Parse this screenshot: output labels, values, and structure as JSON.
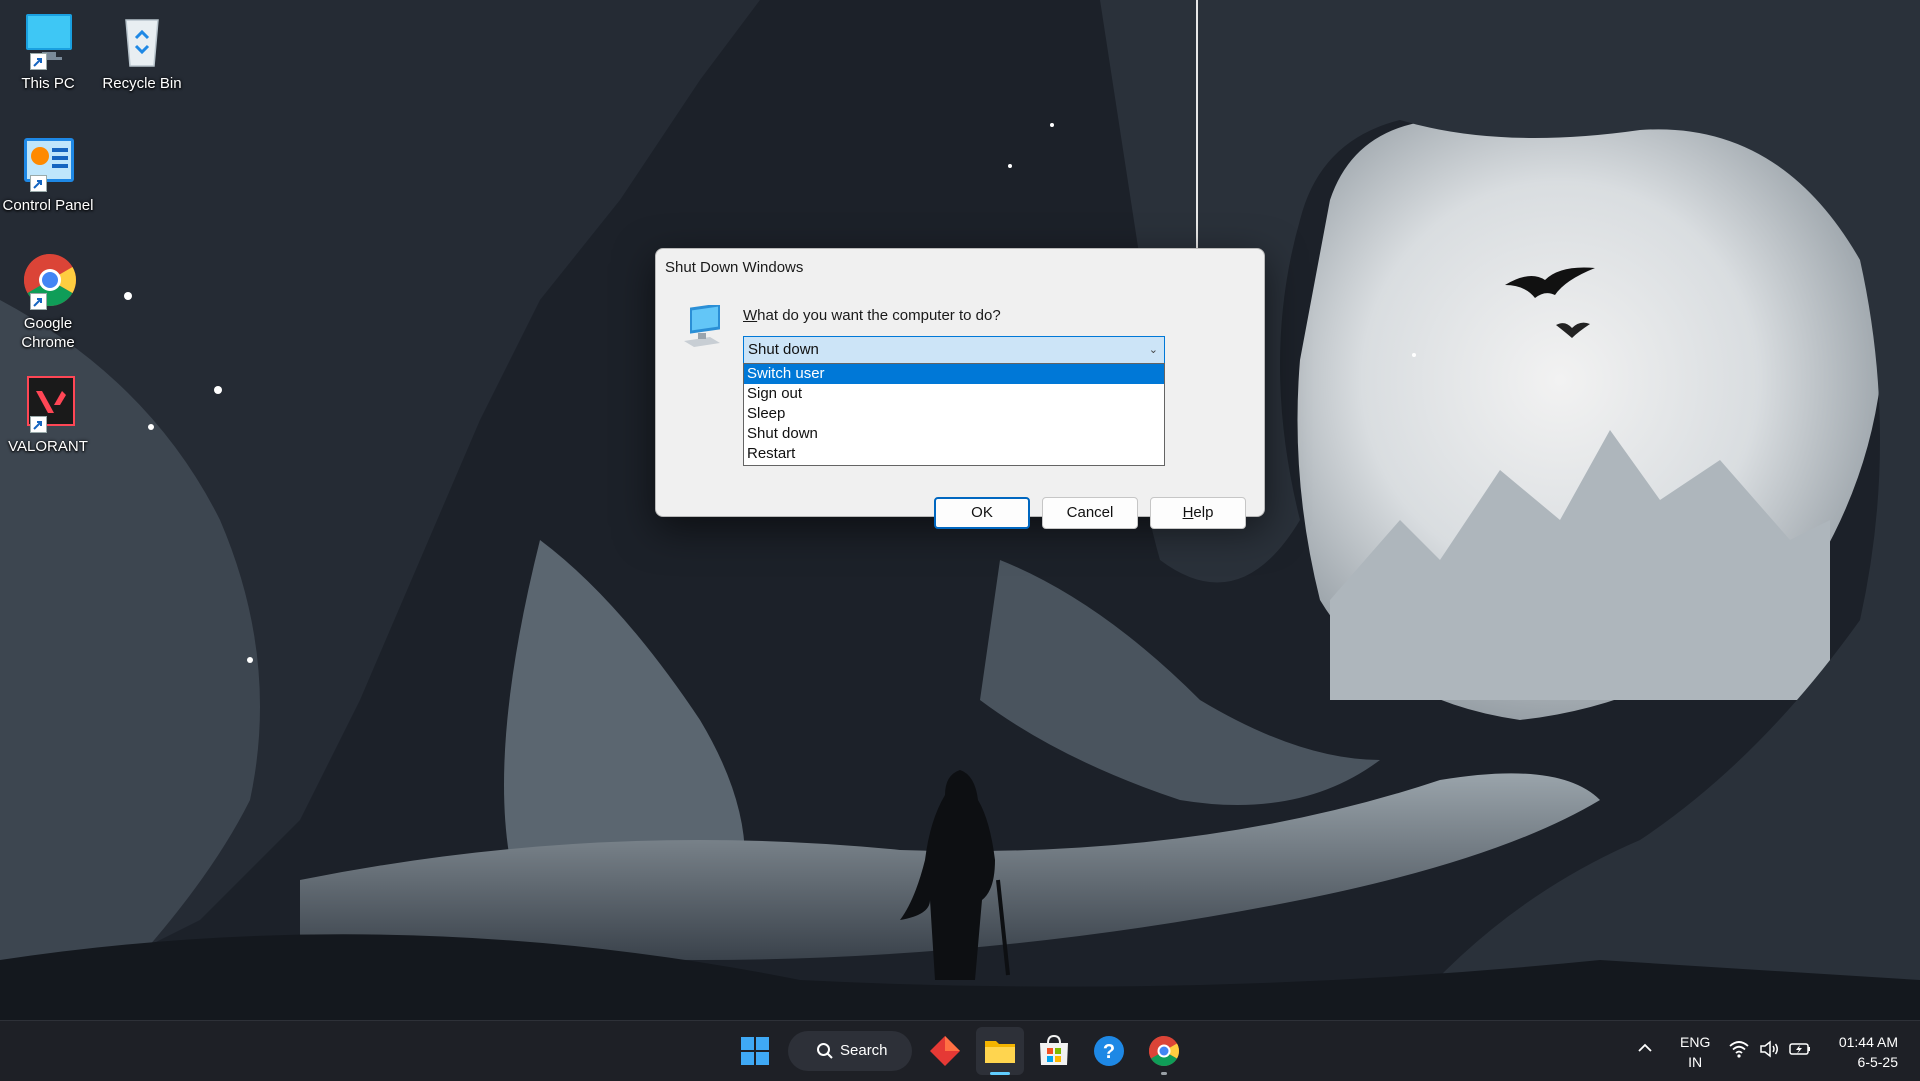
{
  "desktop": {
    "icons": [
      {
        "label": "This PC",
        "icon": "monitor-icon"
      },
      {
        "label": "Recycle Bin",
        "icon": "recycle-bin-icon"
      },
      {
        "label": "Control Panel",
        "icon": "control-panel-icon"
      },
      {
        "label": "Google Chrome",
        "icon": "chrome-icon"
      },
      {
        "label": "VALORANT",
        "icon": "valorant-icon"
      }
    ]
  },
  "dialog": {
    "title": "Shut Down Windows",
    "prompt_first": "W",
    "prompt_rest": "hat do you want the computer to do?",
    "selected_value": "Shut down",
    "options": [
      "Switch user",
      "Sign out",
      "Sleep",
      "Shut down",
      "Restart"
    ],
    "highlighted_option": "Switch user",
    "buttons": {
      "ok": "OK",
      "cancel": "Cancel",
      "help_first": "H",
      "help_rest": "elp"
    }
  },
  "taskbar": {
    "search_label": "Search",
    "pinned": [
      "start-icon",
      "search-icon",
      "red-diamond-app-icon",
      "file-explorer-icon",
      "microsoft-store-icon",
      "help-icon",
      "chrome-icon"
    ],
    "tray": {
      "lang_line1": "ENG",
      "lang_line2": "IN",
      "time": "01:44 AM",
      "date": "6-5-25"
    }
  },
  "colors": {
    "accent": "#0078d7",
    "combo_bg": "#cce4f7",
    "dialog_bg": "#f0f0f0",
    "taskbar_bg": "#1e2026"
  }
}
